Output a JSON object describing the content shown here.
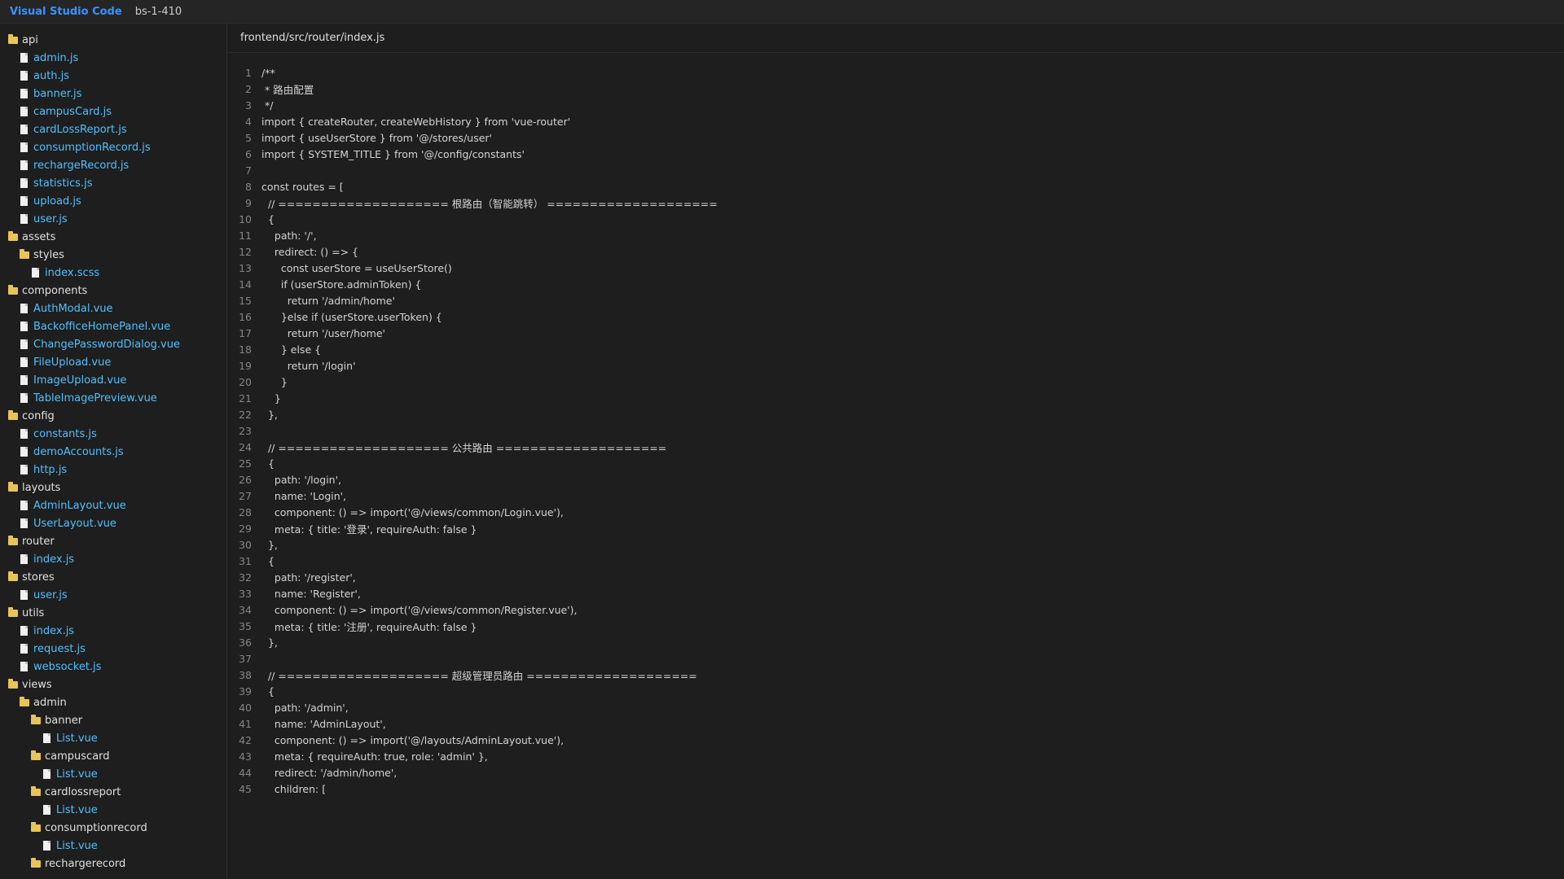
{
  "titlebar": {
    "app": "Visual Studio Code",
    "workspace": "bs-1-410"
  },
  "editor": {
    "tab_path": "frontend/src/router/index.js"
  },
  "tree": [
    {
      "type": "folder",
      "depth": 0,
      "label": "api"
    },
    {
      "type": "file",
      "depth": 1,
      "label": "admin.js"
    },
    {
      "type": "file",
      "depth": 1,
      "label": "auth.js"
    },
    {
      "type": "file",
      "depth": 1,
      "label": "banner.js"
    },
    {
      "type": "file",
      "depth": 1,
      "label": "campusCard.js"
    },
    {
      "type": "file",
      "depth": 1,
      "label": "cardLossReport.js"
    },
    {
      "type": "file",
      "depth": 1,
      "label": "consumptionRecord.js"
    },
    {
      "type": "file",
      "depth": 1,
      "label": "rechargeRecord.js"
    },
    {
      "type": "file",
      "depth": 1,
      "label": "statistics.js"
    },
    {
      "type": "file",
      "depth": 1,
      "label": "upload.js"
    },
    {
      "type": "file",
      "depth": 1,
      "label": "user.js"
    },
    {
      "type": "folder",
      "depth": 0,
      "label": "assets"
    },
    {
      "type": "folder",
      "depth": 1,
      "label": "styles"
    },
    {
      "type": "file",
      "depth": 2,
      "label": "index.scss"
    },
    {
      "type": "folder",
      "depth": 0,
      "label": "components"
    },
    {
      "type": "file",
      "depth": 1,
      "label": "AuthModal.vue"
    },
    {
      "type": "file",
      "depth": 1,
      "label": "BackofficeHomePanel.vue"
    },
    {
      "type": "file",
      "depth": 1,
      "label": "ChangePasswordDialog.vue"
    },
    {
      "type": "file",
      "depth": 1,
      "label": "FileUpload.vue"
    },
    {
      "type": "file",
      "depth": 1,
      "label": "ImageUpload.vue"
    },
    {
      "type": "file",
      "depth": 1,
      "label": "TableImagePreview.vue"
    },
    {
      "type": "folder",
      "depth": 0,
      "label": "config"
    },
    {
      "type": "file",
      "depth": 1,
      "label": "constants.js"
    },
    {
      "type": "file",
      "depth": 1,
      "label": "demoAccounts.js"
    },
    {
      "type": "file",
      "depth": 1,
      "label": "http.js"
    },
    {
      "type": "folder",
      "depth": 0,
      "label": "layouts"
    },
    {
      "type": "file",
      "depth": 1,
      "label": "AdminLayout.vue"
    },
    {
      "type": "file",
      "depth": 1,
      "label": "UserLayout.vue"
    },
    {
      "type": "folder",
      "depth": 0,
      "label": "router"
    },
    {
      "type": "file",
      "depth": 1,
      "label": "index.js"
    },
    {
      "type": "folder",
      "depth": 0,
      "label": "stores"
    },
    {
      "type": "file",
      "depth": 1,
      "label": "user.js"
    },
    {
      "type": "folder",
      "depth": 0,
      "label": "utils"
    },
    {
      "type": "file",
      "depth": 1,
      "label": "index.js"
    },
    {
      "type": "file",
      "depth": 1,
      "label": "request.js"
    },
    {
      "type": "file",
      "depth": 1,
      "label": "websocket.js"
    },
    {
      "type": "folder",
      "depth": 0,
      "label": "views"
    },
    {
      "type": "folder",
      "depth": 1,
      "label": "admin"
    },
    {
      "type": "folder",
      "depth": 2,
      "label": "banner"
    },
    {
      "type": "file",
      "depth": 3,
      "label": "List.vue"
    },
    {
      "type": "folder",
      "depth": 2,
      "label": "campuscard"
    },
    {
      "type": "file",
      "depth": 3,
      "label": "List.vue"
    },
    {
      "type": "folder",
      "depth": 2,
      "label": "cardlossreport"
    },
    {
      "type": "file",
      "depth": 3,
      "label": "List.vue"
    },
    {
      "type": "folder",
      "depth": 2,
      "label": "consumptionrecord"
    },
    {
      "type": "file",
      "depth": 3,
      "label": "List.vue"
    },
    {
      "type": "folder",
      "depth": 2,
      "label": "rechargerecord"
    }
  ],
  "code_lines": [
    "/**",
    " * 路由配置",
    " */",
    "import { createRouter, createWebHistory } from 'vue-router'",
    "import { useUserStore } from '@/stores/user'",
    "import { SYSTEM_TITLE } from '@/config/constants'",
    "",
    "const routes = [",
    "  // ==================== 根路由（智能跳转） ====================",
    "  {",
    "    path: '/',",
    "    redirect: () => {",
    "      const userStore = useUserStore()",
    "      if (userStore.adminToken) {",
    "        return '/admin/home'",
    "      }else if (userStore.userToken) {",
    "        return '/user/home'",
    "      } else {",
    "        return '/login'",
    "      }",
    "    }",
    "  },",
    "",
    "  // ==================== 公共路由 ====================",
    "  {",
    "    path: '/login',",
    "    name: 'Login',",
    "    component: () => import('@/views/common/Login.vue'),",
    "    meta: { title: '登录', requireAuth: false }",
    "  },",
    "  {",
    "    path: '/register',",
    "    name: 'Register',",
    "    component: () => import('@/views/common/Register.vue'),",
    "    meta: { title: '注册', requireAuth: false }",
    "  },",
    "",
    "  // ==================== 超级管理员路由 ====================",
    "  {",
    "    path: '/admin',",
    "    name: 'AdminLayout',",
    "    component: () => import('@/layouts/AdminLayout.vue'),",
    "    meta: { requireAuth: true, role: 'admin' },",
    "    redirect: '/admin/home',",
    "    children: ["
  ]
}
